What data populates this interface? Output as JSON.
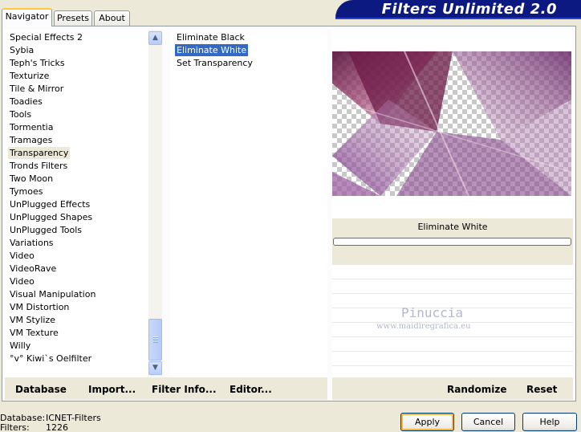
{
  "tabs": [
    {
      "label": "Navigator",
      "active": true
    },
    {
      "label": "Presets",
      "active": false
    },
    {
      "label": "About",
      "active": false
    }
  ],
  "banner": {
    "title": "Filters Unlimited 2.0"
  },
  "categories": [
    "Special Effects 2",
    "Sybia",
    "Teph's Tricks",
    "Texturize",
    "Tile & Mirror",
    "Toadies",
    "Tools",
    "Tormentia",
    "Tramages",
    "Transparency",
    "Tronds Filters",
    "Two Moon",
    "Tymoes",
    "UnPlugged Effects",
    "UnPlugged Shapes",
    "UnPlugged Tools",
    "Variations",
    "Video",
    "VideoRave",
    "Video",
    "Visual Manipulation",
    "VM Distortion",
    "VM Stylize",
    "VM Texture",
    "Willy",
    "°v° Kiwi`s Oelfilter"
  ],
  "selected_category": "Transparency",
  "filters": [
    "Eliminate Black",
    "Eliminate White",
    "Set Transparency"
  ],
  "selected_filter": "Eliminate White",
  "preview": {
    "filter_name": "Eliminate White"
  },
  "watermark": {
    "name": "Pinuccia",
    "url": "www.maidiregrafica.eu"
  },
  "toolbar": {
    "database": "Database",
    "import": "Import...",
    "filter_info": "Filter Info...",
    "editor": "Editor...",
    "randomize": "Randomize",
    "reset": "Reset"
  },
  "footer": {
    "database_label": "Database:",
    "database_value": "ICNET-Filters",
    "filters_label": "Filters:",
    "filters_value": "1226"
  },
  "buttons": {
    "apply": "Apply",
    "cancel": "Cancel",
    "help": "Help"
  },
  "colors": {
    "accent": "#316ac5",
    "banner": "#0c1980",
    "focus": "#f8b33a"
  }
}
